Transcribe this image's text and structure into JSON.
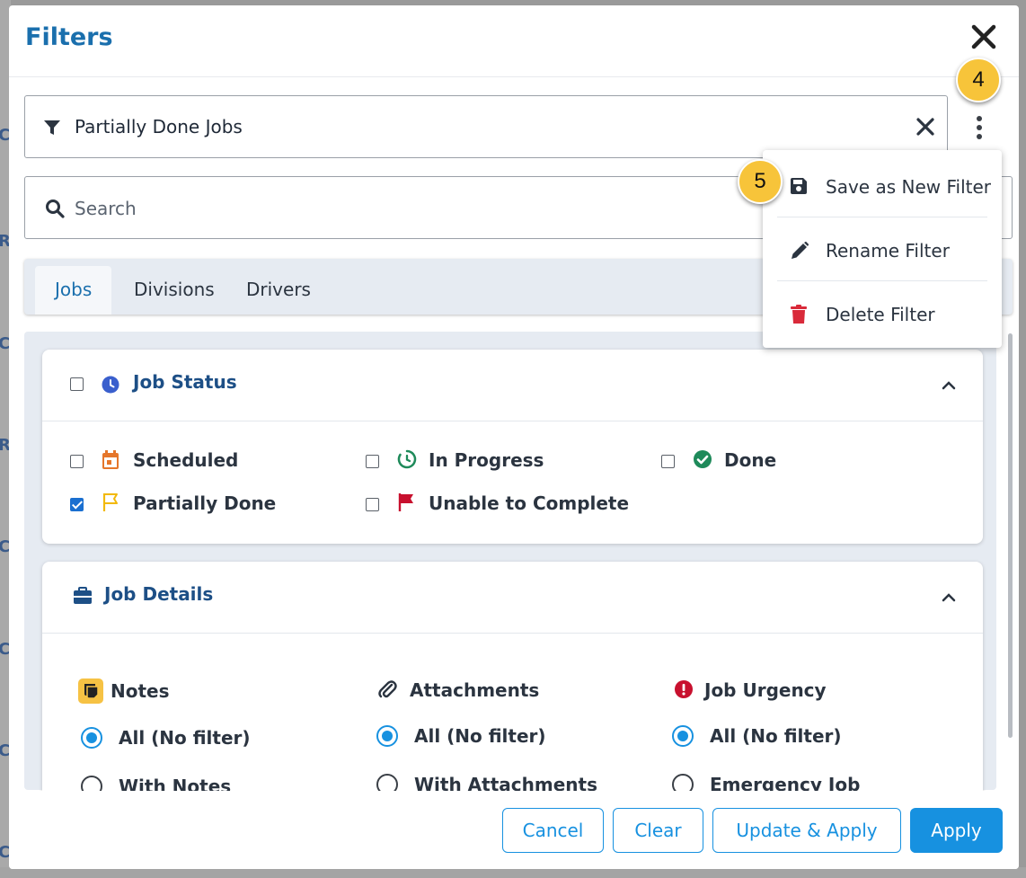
{
  "modal": {
    "title": "Filters"
  },
  "filter": {
    "name": "Partially Done Jobs"
  },
  "search": {
    "placeholder": "Search"
  },
  "tabs": [
    {
      "label": "Jobs"
    },
    {
      "label": "Divisions"
    },
    {
      "label": "Drivers"
    }
  ],
  "job_status": {
    "title": "Job Status",
    "options": [
      {
        "label": "Scheduled",
        "checked": false
      },
      {
        "label": "In Progress",
        "checked": false
      },
      {
        "label": "Done",
        "checked": false
      },
      {
        "label": "Partially Done",
        "checked": true
      },
      {
        "label": "Unable to Complete",
        "checked": false
      }
    ]
  },
  "job_details": {
    "title": "Job Details",
    "groups": [
      {
        "title": "Notes",
        "options": [
          "All (No filter)",
          "With Notes"
        ]
      },
      {
        "title": "Attachments",
        "options": [
          "All (No filter)",
          "With Attachments"
        ]
      },
      {
        "title": "Job Urgency",
        "options": [
          "All (No filter)",
          "Emergency Job"
        ]
      }
    ]
  },
  "menu": {
    "items": [
      {
        "label": "Save as New Filter",
        "icon": "floppy-disk-icon"
      },
      {
        "label": "Rename Filter",
        "icon": "pencil-icon"
      },
      {
        "label": "Delete Filter",
        "icon": "trash-icon"
      }
    ]
  },
  "footer": {
    "cancel": "Cancel",
    "clear": "Clear",
    "update_apply": "Update & Apply",
    "apply": "Apply"
  },
  "badges": {
    "step4": "4",
    "step5": "5"
  },
  "colors": {
    "accent": "#1791e0",
    "title_blue": "#1a6fad",
    "badge_yellow": "#f7c43a",
    "status_orange": "#e5762b",
    "status_green": "#1e8a5a",
    "status_red": "#c8102e",
    "partial_yellow": "#f2b90c"
  }
}
